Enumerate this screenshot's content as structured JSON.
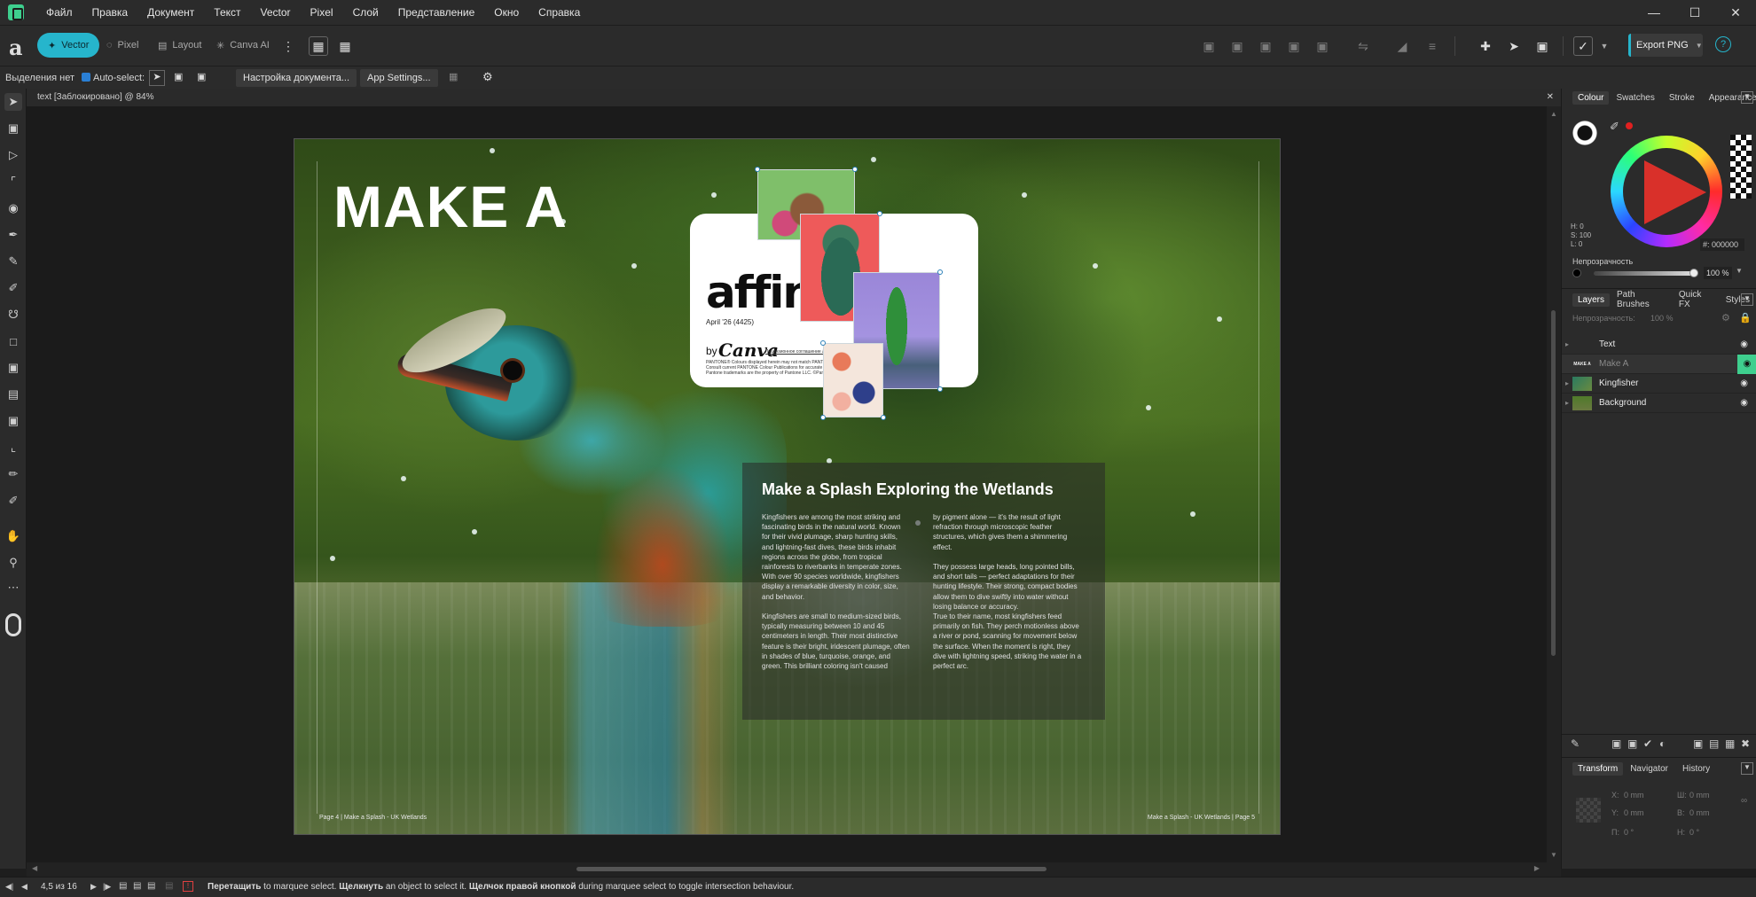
{
  "menubar": {
    "items": [
      "Файл",
      "Правка",
      "Документ",
      "Текст",
      "Vector",
      "Pixel",
      "Слой",
      "Представление",
      "Окно",
      "Справка"
    ],
    "min_icon": "minimize-icon",
    "max_icon": "maximize-icon",
    "close_icon": "close-icon"
  },
  "toolbar": {
    "personas": [
      "Vector",
      "Pixel",
      "Layout",
      "Canva AI"
    ],
    "active_persona": "Vector",
    "export_label": "Export PNG",
    "accent": "#26b5cc"
  },
  "ctxbar": {
    "selection_label": "Выделения нет",
    "autoselect_label": "Auto-select:",
    "doc_setup_label": "Настройка документа...",
    "app_settings_label": "App Settings..."
  },
  "doctab": {
    "title": "text [Заблокировано] @ 84%"
  },
  "artwork": {
    "headline": "MAKE A",
    "card": {
      "logo": "affinity",
      "date": "April '26 (4425)",
      "by": "by",
      "canva": "Canva",
      "links": "Лицензионное соглашение   Лицензии третьих сторон",
      "legal": "PANTONE® Colours displayed herein may not match PANTONE-identified standards. Consult current PANTONE Colour Publications for accurate colour. PANTONE® and other Pantone trademarks are the property of Pantone LLC. ©Pantone LLC, 2025."
    },
    "article": {
      "title": "Make a Splash Exploring the Wetlands",
      "col1": "Kingfishers are among the most striking and fascinating birds in the natural world. Known for their vivid plumage, sharp hunting skills, and lightning-fast dives, these birds inhabit regions across the globe, from tropical rainforests to riverbanks in temperate zones. With over 90 species worldwide, kingfishers display a remarkable diversity in color, size, and behavior.\n\nKingfishers are small to medium-sized birds, typically measuring between 10 and 45 centimeters in length. Their most distinctive feature is their bright, iridescent plumage, often in shades of blue, turquoise, orange, and green. This brilliant coloring isn't caused",
      "col2": "by pigment alone — it's the result of light refraction through microscopic feather structures, which gives them a shimmering effect.\n\nThey possess large heads, long pointed bills, and short tails — perfect adaptations for their hunting lifestyle. Their strong, compact bodies allow them to dive swiftly into water without losing balance or accuracy.\n True to their name, most kingfishers feed primarily on fish. They perch motionless above a river or pond, scanning for movement below the surface. When the moment is right, they dive with lightning speed, striking the water in a perfect arc."
    },
    "folio_left": "Page 4  |  Make a Splash - UK Wetlands",
    "folio_right": "Make a Splash - UK Wetlands  |  Page 5"
  },
  "colour_panel": {
    "tabs": [
      "Colour",
      "Swatches",
      "Stroke",
      "Appearance"
    ],
    "hsl": [
      "H: 0",
      "S: 100",
      "L: 0"
    ],
    "hex": "#: 000000",
    "opacity_label": "Непрозрачность",
    "opacity_value": "100 %"
  },
  "layers_panel": {
    "tabs": [
      "Layers",
      "Path Brushes",
      "Quick FX",
      "Styles"
    ],
    "opacity_label": "Непрозрачность:",
    "opacity_value": "100 %",
    "layers": [
      {
        "name": "Text",
        "selected": false
      },
      {
        "name": "Make A",
        "selected": true,
        "thumb_text": "MAKE A"
      },
      {
        "name": "Kingfisher",
        "selected": false
      },
      {
        "name": "Background",
        "selected": false
      }
    ]
  },
  "transform_panel": {
    "tabs": [
      "Transform",
      "Navigator",
      "History"
    ],
    "fields": [
      "X:",
      "0 mm",
      "Ш:",
      "0 mm",
      "Y:",
      "0 mm",
      "В:",
      "0 mm",
      "П:",
      "0 °",
      "Н:",
      "0 °"
    ]
  },
  "statusbar": {
    "page_label": "4,5 из 16",
    "hint_b1": "Перетащить",
    "hint_t1": " to marquee select. ",
    "hint_b2": "Щелкнуть",
    "hint_t2": " an object to select it. ",
    "hint_b3": "Щелчок правой кнопкой",
    "hint_t3": " during marquee select to toggle intersection behaviour."
  }
}
